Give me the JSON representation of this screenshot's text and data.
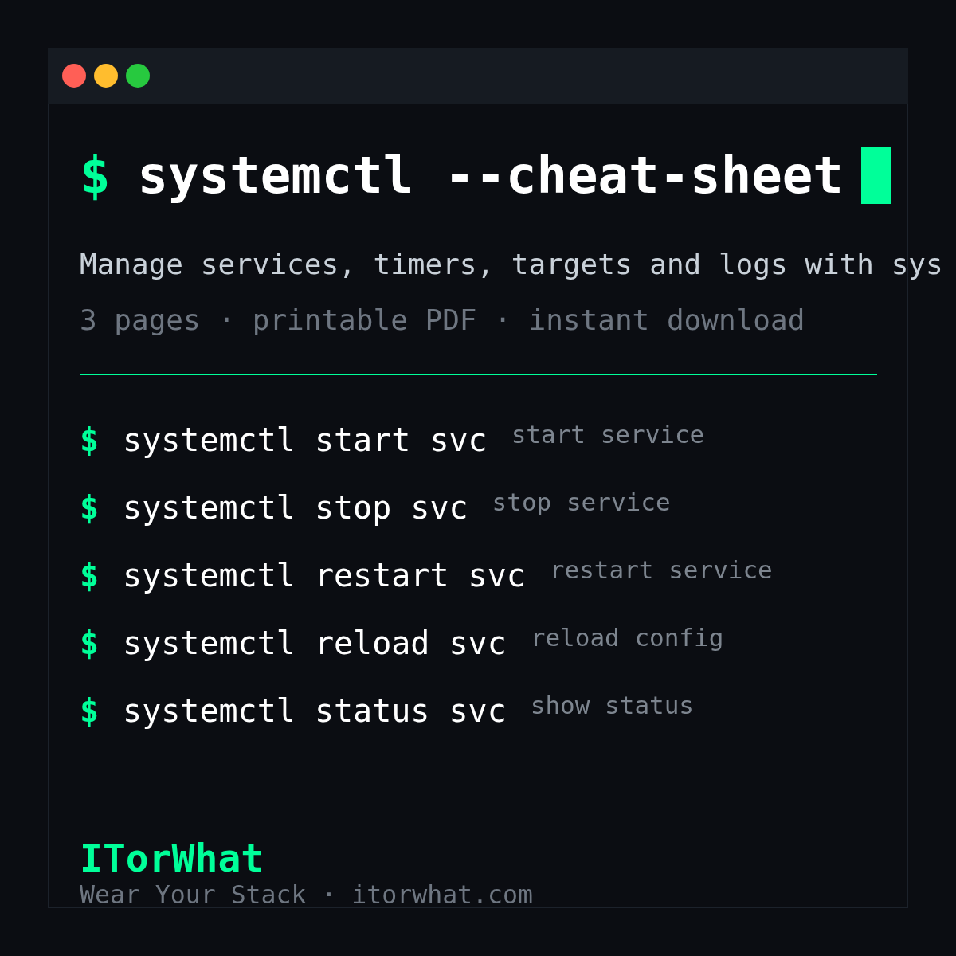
{
  "window": {
    "controls": [
      {
        "color": "#ff5f56"
      },
      {
        "color": "#ffbd2e"
      },
      {
        "color": "#27c93f"
      }
    ]
  },
  "title": {
    "prompt": "$",
    "text": "systemctl --cheat-sheet"
  },
  "subtitle": "Manage services, timers, targets and logs with sys",
  "meta": "3 pages · printable PDF · instant download",
  "commands": [
    {
      "prompt": "$",
      "command": "systemctl start svc",
      "description": "start service"
    },
    {
      "prompt": "$",
      "command": "systemctl stop svc",
      "description": "stop service"
    },
    {
      "prompt": "$",
      "command": "systemctl restart svc",
      "description": "restart service"
    },
    {
      "prompt": "$",
      "command": "systemctl reload svc",
      "description": "reload config"
    },
    {
      "prompt": "$",
      "command": "systemctl status svc",
      "description": "show status"
    }
  ],
  "footer": {
    "brand": "ITorWhat",
    "tagline": "Wear Your Stack · itorwhat.com"
  }
}
